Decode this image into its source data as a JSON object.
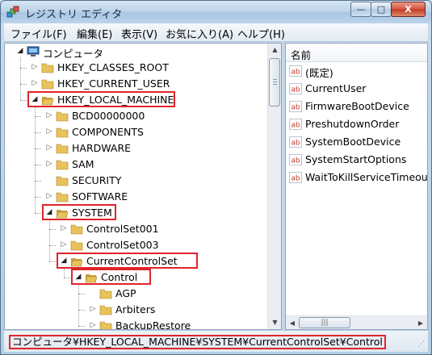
{
  "window": {
    "title": "レジストリ エディタ",
    "buttons": {
      "minimize": "—",
      "maximize": "□",
      "close": "X"
    }
  },
  "menu": [
    "ファイル(F)",
    "編集(E)",
    "表示(V)",
    "お気に入り(A)",
    "ヘルプ(H)"
  ],
  "tree": {
    "root": "コンピュータ",
    "nodes": [
      "HKEY_CLASSES_ROOT",
      "HKEY_CURRENT_USER",
      "HKEY_LOCAL_MACHINE",
      "BCD00000000",
      "COMPONENTS",
      "HARDWARE",
      "SAM",
      "SECURITY",
      "SOFTWARE",
      "SYSTEM",
      "ControlSet001",
      "ControlSet003",
      "CurrentControlSet",
      "Control",
      "AGP",
      "Arbiters",
      "BackupRestore"
    ]
  },
  "values": {
    "column_header": "名前",
    "items": [
      "(既定)",
      "CurrentUser",
      "FirmwareBootDevice",
      "PreshutdownOrder",
      "SystemBootDevice",
      "SystemStartOptions",
      "WaitToKillServiceTimeout"
    ]
  },
  "status": {
    "path": "コンピュータ¥HKEY_LOCAL_MACHINE¥SYSTEM¥CurrentControlSet¥Control"
  },
  "colors": {
    "highlight": "#e0242a",
    "folder": "#e8c35a"
  }
}
